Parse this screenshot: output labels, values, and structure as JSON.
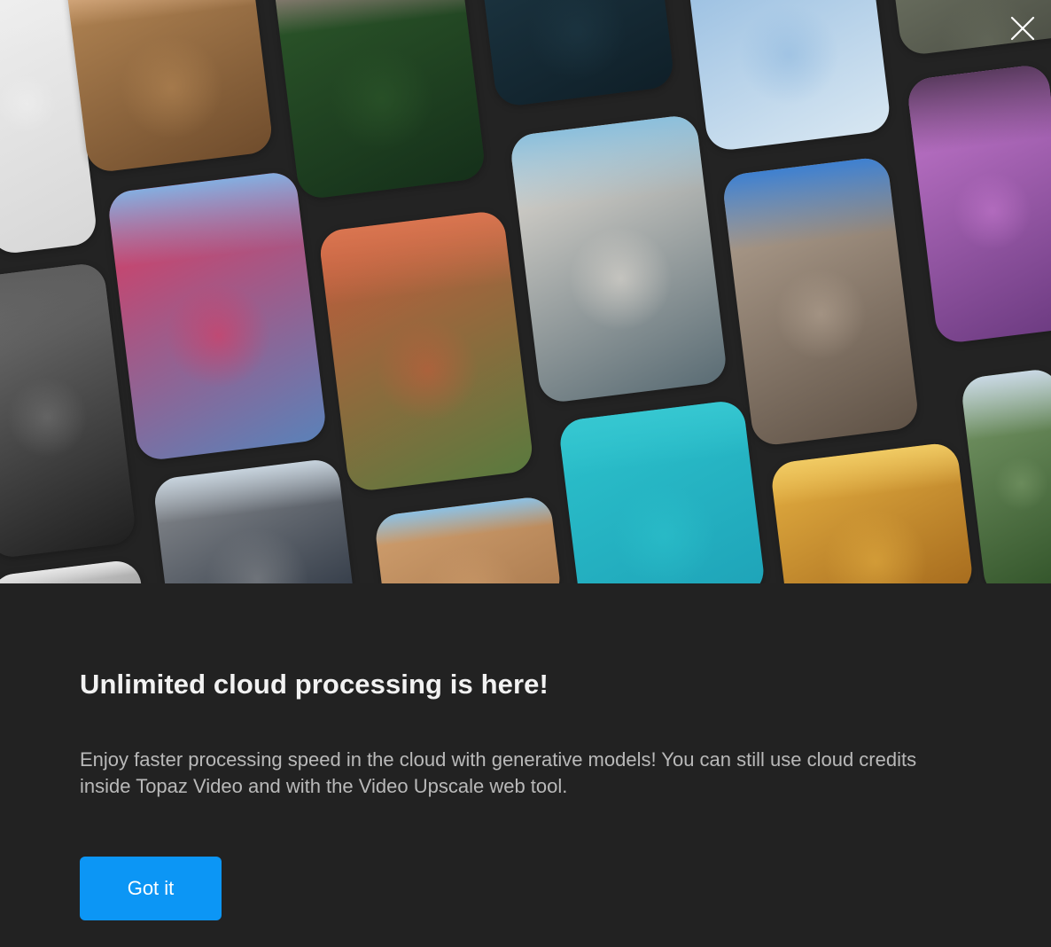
{
  "dialog": {
    "title": "Unlimited cloud processing is here!",
    "body": "Enjoy faster processing speed in the cloud with generative models! You can still use cloud credits inside Topaz Video and with the Video Upscale web tool.",
    "primary_button_label": "Got it",
    "close_icon": "close-icon"
  },
  "gallery": {
    "tiles": [
      {
        "name": "tile-white-fabric",
        "c1": "#f1f1f1",
        "c2": "#d7d7d7",
        "sky": "#eeeeee"
      },
      {
        "name": "tile-beach-cliff",
        "c1": "#b88a57",
        "c2": "#6f4c2c",
        "sky": "#f0c59f"
      },
      {
        "name": "tile-palm-forest",
        "c1": "#2e5a2b",
        "c2": "#15301a",
        "sky": "#c393a0"
      },
      {
        "name": "tile-boat-water",
        "c1": "#1f3a47",
        "c2": "#0f1f28",
        "sky": "#eef1f2"
      },
      {
        "name": "tile-ferris-wheel",
        "c1": "#8db7de",
        "c2": "#d8e7f2",
        "sky": "#df5a2f"
      },
      {
        "name": "tile-park-bench",
        "c1": "#6b7060",
        "c2": "#4c4f45",
        "sky": "#a3a08c"
      },
      {
        "name": "tile-pink-monster",
        "c1": "#c77ad0",
        "c2": "#6b3a80",
        "sky": "#5a3b5f"
      },
      {
        "name": "tile-bird-fence",
        "c1": "#787878",
        "c2": "#202020",
        "sky": "#5d5d5d"
      },
      {
        "name": "tile-woman-portrait",
        "c1": "#e0375d",
        "c2": "#5b81b8",
        "sky": "#84aee0"
      },
      {
        "name": "tile-brick-flowers",
        "c1": "#c65a3c",
        "c2": "#5a7a3e",
        "sky": "#d97550"
      },
      {
        "name": "tile-two-women",
        "c1": "#e8e1d8",
        "c2": "#5a6c74",
        "sky": "#8bbfdc"
      },
      {
        "name": "tile-louvre-building",
        "c1": "#b8a796",
        "c2": "#5f5246",
        "sky": "#3e80d0"
      },
      {
        "name": "tile-mountain-trees",
        "c1": "#7c9c6b",
        "c2": "#2f5127",
        "sky": "#c9d8e4"
      },
      {
        "name": "tile-three-men",
        "c1": "#8a8d91",
        "c2": "#2a3340",
        "sky": "#c7d3dd"
      },
      {
        "name": "tile-domed-church",
        "c1": "#d1a06f",
        "c2": "#ab7b4f",
        "sky": "#8cc0e3"
      },
      {
        "name": "tile-surfers-ocean",
        "c1": "#2cc2cc",
        "c2": "#1ea3b8",
        "sky": "#36c7d1"
      },
      {
        "name": "tile-golden-leaves",
        "c1": "#e5b042",
        "c2": "#a56a1d",
        "sky": "#f0ca63"
      },
      {
        "name": "tile-silver-corner",
        "c1": "#d9d9d9",
        "c2": "#9a9a9a",
        "sky": "#e6e6e6"
      }
    ]
  }
}
